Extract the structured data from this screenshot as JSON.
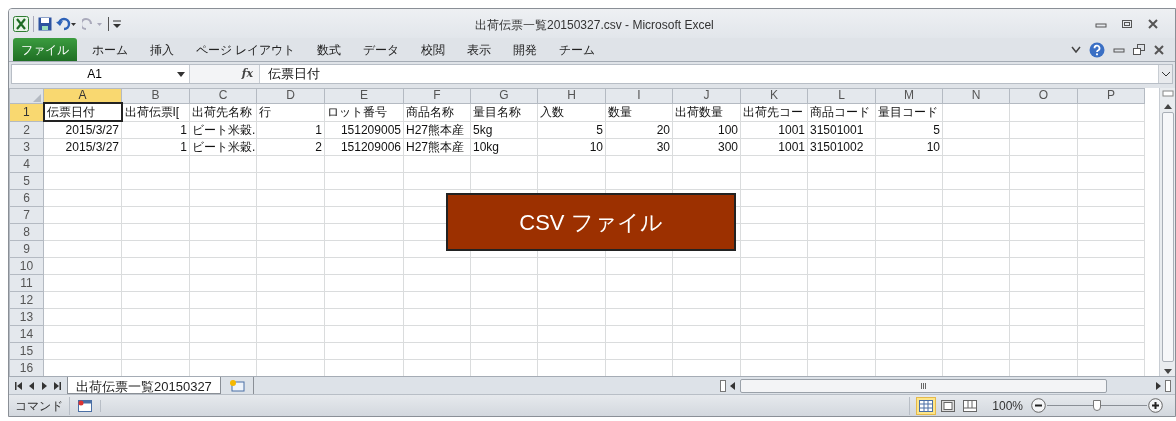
{
  "window": {
    "title": "出荷伝票一覧20150327.csv - Microsoft Excel"
  },
  "ribbon_tabs": [
    {
      "label": "ファイル",
      "kind": "file"
    },
    {
      "label": "ホーム",
      "kind": "tab"
    },
    {
      "label": "挿入",
      "kind": "tab"
    },
    {
      "label": "ページ レイアウト",
      "kind": "tab"
    },
    {
      "label": "数式",
      "kind": "tab"
    },
    {
      "label": "データ",
      "kind": "tab"
    },
    {
      "label": "校閲",
      "kind": "tab"
    },
    {
      "label": "表示",
      "kind": "tab"
    },
    {
      "label": "開発",
      "kind": "tab"
    },
    {
      "label": "チーム",
      "kind": "tab"
    }
  ],
  "formula_bar": {
    "name_box": "A1",
    "fx": "fx",
    "formula": "伝票日付"
  },
  "sheet": {
    "columns": [
      {
        "label": "A",
        "selected": true
      },
      {
        "label": "B",
        "selected": false
      },
      {
        "label": "C",
        "selected": false
      },
      {
        "label": "D",
        "selected": false
      },
      {
        "label": "E",
        "selected": false
      },
      {
        "label": "F",
        "selected": false
      },
      {
        "label": "G",
        "selected": false
      },
      {
        "label": "H",
        "selected": false
      },
      {
        "label": "I",
        "selected": false
      },
      {
        "label": "J",
        "selected": false
      },
      {
        "label": "K",
        "selected": false
      },
      {
        "label": "L",
        "selected": false
      },
      {
        "label": "M",
        "selected": false
      },
      {
        "label": "N",
        "selected": false
      },
      {
        "label": "O",
        "selected": false
      },
      {
        "label": "P",
        "selected": false
      }
    ],
    "rows": [
      {
        "label": "1",
        "selected": true,
        "cells": [
          {
            "text": "伝票日付",
            "kind": "text",
            "selected": true
          },
          {
            "text": "出荷伝票I[",
            "kind": "text",
            "selected": false
          },
          {
            "text": "出荷先名称",
            "kind": "text",
            "selected": false
          },
          {
            "text": "行",
            "kind": "text",
            "selected": false
          },
          {
            "text": "ロット番号",
            "kind": "text",
            "selected": false
          },
          {
            "text": "商品名称",
            "kind": "text",
            "selected": false
          },
          {
            "text": "量目名称",
            "kind": "text",
            "selected": false
          },
          {
            "text": "入数",
            "kind": "text",
            "selected": false
          },
          {
            "text": "数量",
            "kind": "text",
            "selected": false
          },
          {
            "text": "出荷数量",
            "kind": "text",
            "selected": false
          },
          {
            "text": "出荷先コー",
            "kind": "text",
            "selected": false
          },
          {
            "text": "商品コード",
            "kind": "text",
            "selected": false
          },
          {
            "text": "量目コード",
            "kind": "text",
            "selected": false
          }
        ]
      },
      {
        "label": "2",
        "selected": false,
        "cells": [
          {
            "text": "2015/3/27",
            "kind": "number",
            "selected": false
          },
          {
            "text": "1",
            "kind": "number",
            "selected": false
          },
          {
            "text": "ビート米穀.",
            "kind": "text",
            "selected": false
          },
          {
            "text": "1",
            "kind": "number",
            "selected": false
          },
          {
            "text": "151209005",
            "kind": "number",
            "selected": false
          },
          {
            "text": "H27熊本産",
            "kind": "text",
            "selected": false
          },
          {
            "text": "5kg",
            "kind": "text",
            "selected": false
          },
          {
            "text": "5",
            "kind": "number",
            "selected": false
          },
          {
            "text": "20",
            "kind": "number",
            "selected": false
          },
          {
            "text": "100",
            "kind": "number",
            "selected": false
          },
          {
            "text": "1001",
            "kind": "number",
            "selected": false
          },
          {
            "text": "31501001",
            "kind": "text",
            "selected": false
          },
          {
            "text": "5",
            "kind": "number",
            "selected": false
          }
        ]
      },
      {
        "label": "3",
        "selected": false,
        "cells": [
          {
            "text": "2015/3/27",
            "kind": "number",
            "selected": false
          },
          {
            "text": "1",
            "kind": "number",
            "selected": false
          },
          {
            "text": "ビート米穀.",
            "kind": "text",
            "selected": false
          },
          {
            "text": "2",
            "kind": "number",
            "selected": false
          },
          {
            "text": "151209006",
            "kind": "number",
            "selected": false
          },
          {
            "text": "H27熊本産",
            "kind": "text",
            "selected": false
          },
          {
            "text": "10kg",
            "kind": "text",
            "selected": false
          },
          {
            "text": "10",
            "kind": "number",
            "selected": false
          },
          {
            "text": "30",
            "kind": "number",
            "selected": false
          },
          {
            "text": "300",
            "kind": "number",
            "selected": false
          },
          {
            "text": "1001",
            "kind": "number",
            "selected": false
          },
          {
            "text": "31501002",
            "kind": "text",
            "selected": false
          },
          {
            "text": "10",
            "kind": "number",
            "selected": false
          }
        ]
      },
      {
        "label": "4",
        "selected": false,
        "cells": []
      },
      {
        "label": "5",
        "selected": false,
        "cells": []
      },
      {
        "label": "6",
        "selected": false,
        "cells": []
      },
      {
        "label": "7",
        "selected": false,
        "cells": []
      },
      {
        "label": "8",
        "selected": false,
        "cells": []
      },
      {
        "label": "9",
        "selected": false,
        "cells": []
      },
      {
        "label": "10",
        "selected": false,
        "cells": []
      },
      {
        "label": "11",
        "selected": false,
        "cells": []
      },
      {
        "label": "12",
        "selected": false,
        "cells": []
      },
      {
        "label": "13",
        "selected": false,
        "cells": []
      },
      {
        "label": "14",
        "selected": false,
        "cells": []
      },
      {
        "label": "15",
        "selected": false,
        "cells": []
      },
      {
        "label": "16",
        "selected": false,
        "cells": []
      }
    ]
  },
  "overlay": {
    "text": "CSV ファイル"
  },
  "sheet_tabs": [
    {
      "label": "出荷伝票一覧20150327",
      "selected": true
    }
  ],
  "status_bar": {
    "mode": "コマンド",
    "views": [
      {
        "kind": "normal",
        "selected": true
      },
      {
        "kind": "page_layout",
        "selected": false
      },
      {
        "kind": "page_break",
        "selected": false
      }
    ],
    "zoom": "100%",
    "zoom_slider": {
      "level": 0.5
    }
  }
}
